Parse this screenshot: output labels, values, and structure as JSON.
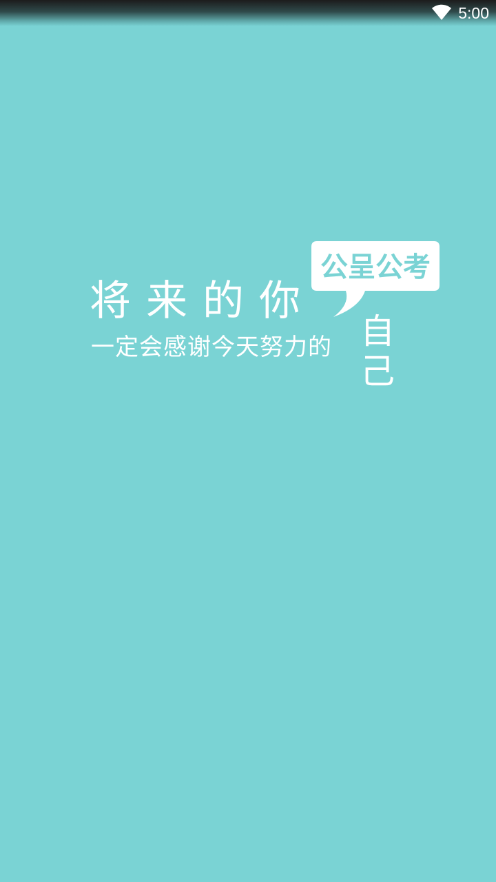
{
  "status_bar": {
    "time": "5:00",
    "wifi_icon": "wifi-icon"
  },
  "splash": {
    "line_one": "将来的你",
    "line_two": "一定会感谢今天努力的",
    "line_vertical": "自己",
    "bubble": {
      "brand": "公呈公考"
    }
  },
  "colors": {
    "background": "#7ad3d4",
    "text": "#ffffff",
    "bubble_fill": "#ffffff",
    "bubble_text": "#7ad3d4"
  }
}
